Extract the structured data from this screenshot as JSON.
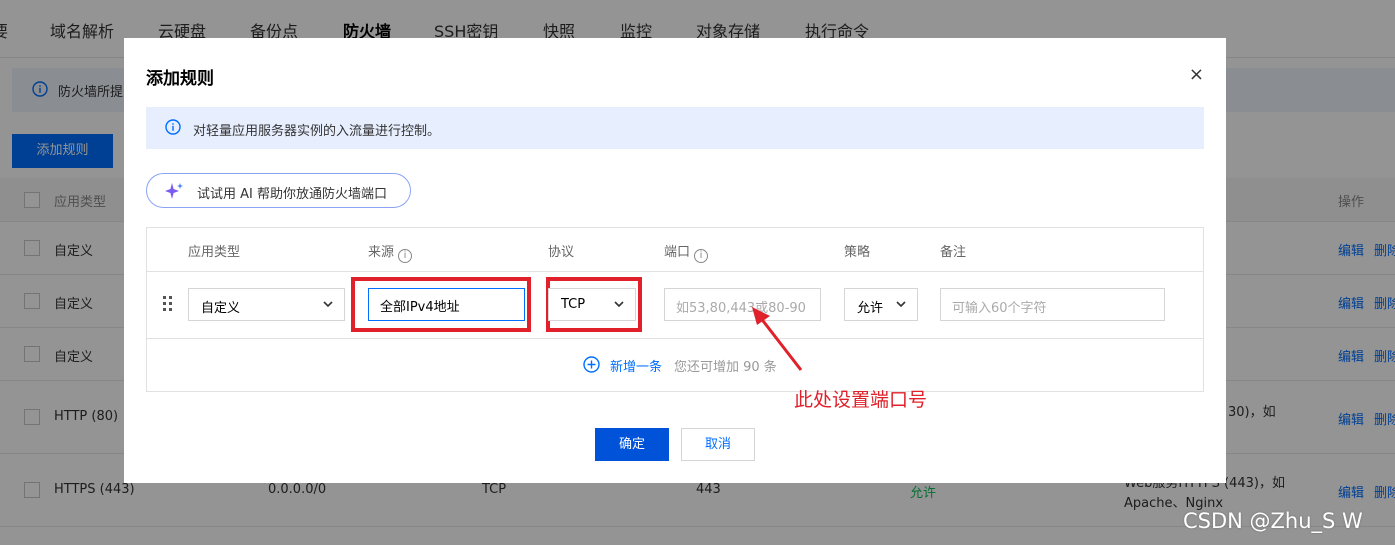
{
  "background": {
    "nav_tabs": [
      "要",
      "域名解析",
      "云硬盘",
      "备份点",
      "防火墙",
      "SSH密钥",
      "快照",
      "监控",
      "对象存储",
      "执行命令"
    ],
    "active_tab": "防火墙",
    "notice_text": "防火墙所提",
    "add_rule_label": "添加规则",
    "table": {
      "col_app_type": "应用类型",
      "col_action": "操作",
      "rows": [
        {
          "app": "自定义",
          "edit": "编辑",
          "delete": "删除"
        },
        {
          "app": "自定义",
          "edit": "编辑",
          "delete": "删除"
        },
        {
          "app": "自定义",
          "edit": "编辑",
          "delete": "删除"
        },
        {
          "app": "HTTP (80)",
          "note": "30)，如",
          "edit": "编辑",
          "delete": "删除"
        },
        {
          "app": "HTTPS (443)",
          "source": "0.0.0.0/0",
          "protocol": "TCP",
          "port": "443",
          "policy": "允许",
          "note_line1": "Web服务HTTPS (443)，如",
          "note_line2": "Apache、Nginx",
          "edit": "编辑",
          "delete": "删除"
        }
      ]
    }
  },
  "modal": {
    "title": "添加规则",
    "close_label": "×",
    "notice": "对轻量应用服务器实例的入流量进行控制。",
    "ai_button": "试试用 AI 帮助你放通防火墙端口",
    "columns": {
      "app_type": "应用类型",
      "source": "来源",
      "protocol": "协议",
      "port": "端口",
      "policy": "策略",
      "note": "备注"
    },
    "row": {
      "app_type": "自定义",
      "source_value": "全部IPv4地址",
      "protocol": "TCP",
      "port_placeholder": "如53,80,443或80-90",
      "policy": "允许",
      "note_placeholder": "可输入60个字符"
    },
    "add_row_label": "新增一条",
    "add_row_hint": "您还可增加 90 条",
    "confirm_label": "确定",
    "cancel_label": "取消"
  },
  "annotation": {
    "text": "此处设置端口号",
    "color": "#e0202a"
  },
  "watermark": "CSDN @Zhu_S W",
  "colors": {
    "primary": "#0052d9",
    "link": "#006eff",
    "highlight": "#e0202a"
  }
}
